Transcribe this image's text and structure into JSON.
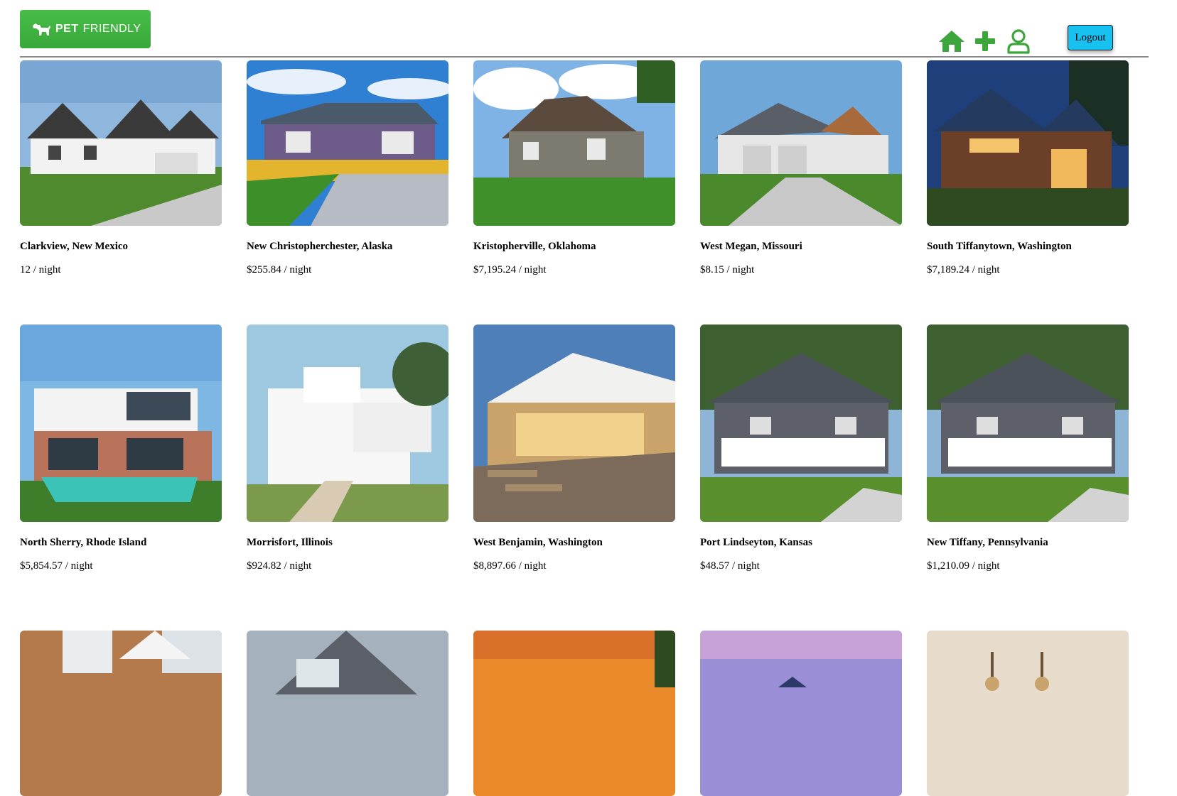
{
  "brand": {
    "name_bold": "PET",
    "name_light": "FRIENDLY",
    "color": "#3eb23f"
  },
  "nav": {
    "icons": [
      "home-icon",
      "plus-icon",
      "user-icon"
    ],
    "icon_color": "#3ca53c",
    "logout_label": "Logout",
    "logout_color": "#17c1f0"
  },
  "listings": [
    {
      "location": "Clarkview, New Mexico",
      "price": "12 / night"
    },
    {
      "location": "New Christopherchester, Alaska",
      "price": "$255.84 / night"
    },
    {
      "location": "Kristopherville, Oklahoma",
      "price": "$7,195.24 / night"
    },
    {
      "location": "West Megan, Missouri",
      "price": "$8.15 / night"
    },
    {
      "location": "South Tiffanytown, Washington",
      "price": "$7,189.24 / night"
    },
    {
      "location": "North Sherry, Rhode Island",
      "price": "$5,854.57 / night"
    },
    {
      "location": "Morrisfort, Illinois",
      "price": "$924.82 / night"
    },
    {
      "location": "West Benjamin, Washington",
      "price": "$8,897.66 / night"
    },
    {
      "location": "Port Lindseyton, Kansas",
      "price": "$48.57 / night"
    },
    {
      "location": "New Tiffany, Pennsylvania",
      "price": "$1,210.09 / night"
    }
  ]
}
